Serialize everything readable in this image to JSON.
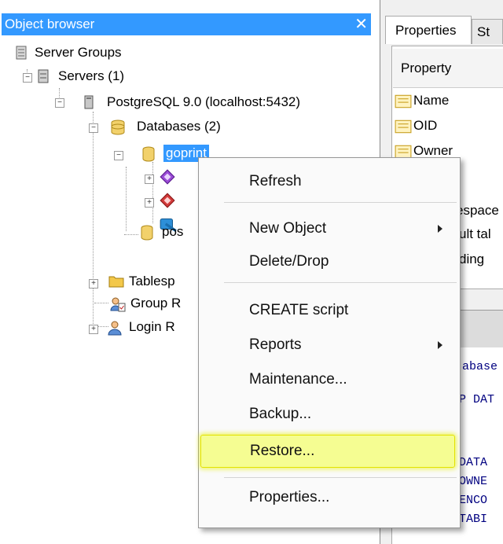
{
  "object_browser": {
    "title": "Object browser",
    "close_icon": "close-icon",
    "tree": {
      "server_groups": "Server Groups",
      "servers": "Servers (1)",
      "postgres": "PostgreSQL 9.0 (localhost:5432)",
      "databases": "Databases (2)",
      "goprint": "goprint",
      "pos": "pos",
      "tablespaces": "Tablesp",
      "group_roles": "Group R",
      "login_roles": "Login R"
    }
  },
  "right_panel": {
    "tabs": [
      "Properties",
      "St"
    ],
    "property_header": "Property",
    "properties": [
      "Name",
      "OID",
      "Owner",
      "espace",
      "ult tal",
      "ding"
    ],
    "sql_lines": [
      "abase",
      "P DAT",
      "DATA",
      "OWNE",
      "ENCO",
      "TABI"
    ]
  },
  "context_menu": {
    "items": {
      "refresh": "Refresh",
      "new_object": "New Object",
      "delete_drop": "Delete/Drop",
      "create_script": "CREATE script",
      "reports": "Reports",
      "maintenance": "Maintenance...",
      "backup": "Backup...",
      "restore": "Restore...",
      "properties": "Properties..."
    },
    "highlight_color": "#f0ff3c"
  }
}
